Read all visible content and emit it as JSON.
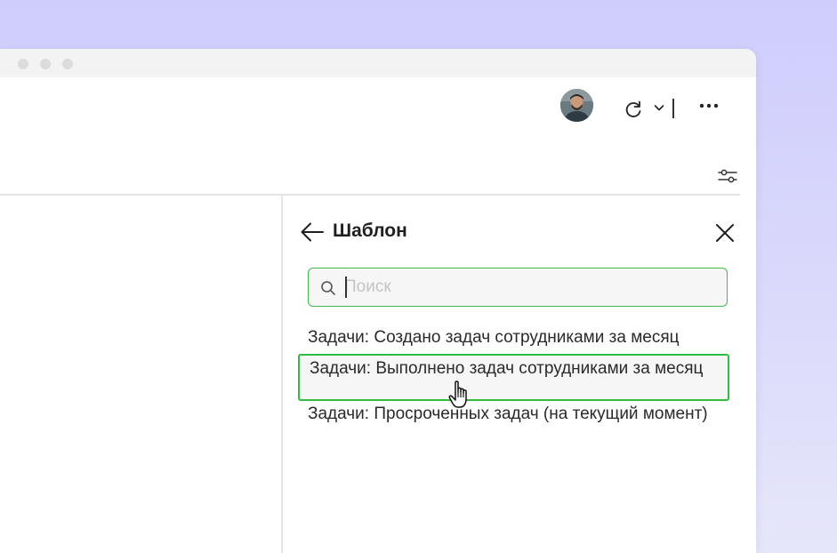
{
  "panel": {
    "title": "Шаблон",
    "search": {
      "placeholder": "Поиск",
      "value": ""
    },
    "templates": [
      {
        "label": "Задачи: Создано задач сотрудниками за месяц"
      },
      {
        "label": "Задачи: Выполнено задач сотрудниками за месяц"
      },
      {
        "label": "Задачи: Просроченных задач (на текущий момент)"
      }
    ]
  },
  "icons": {
    "refresh": "refresh-icon",
    "chevron": "chevron-down-icon",
    "more": "more-horizontal-icon",
    "filter": "sliders-icon",
    "back": "arrow-left-icon",
    "close": "close-icon",
    "search": "search-icon",
    "cursor": "hand-pointer-icon"
  },
  "colors": {
    "accent_green": "#2fbd3e",
    "background": "#cfcdfc"
  }
}
